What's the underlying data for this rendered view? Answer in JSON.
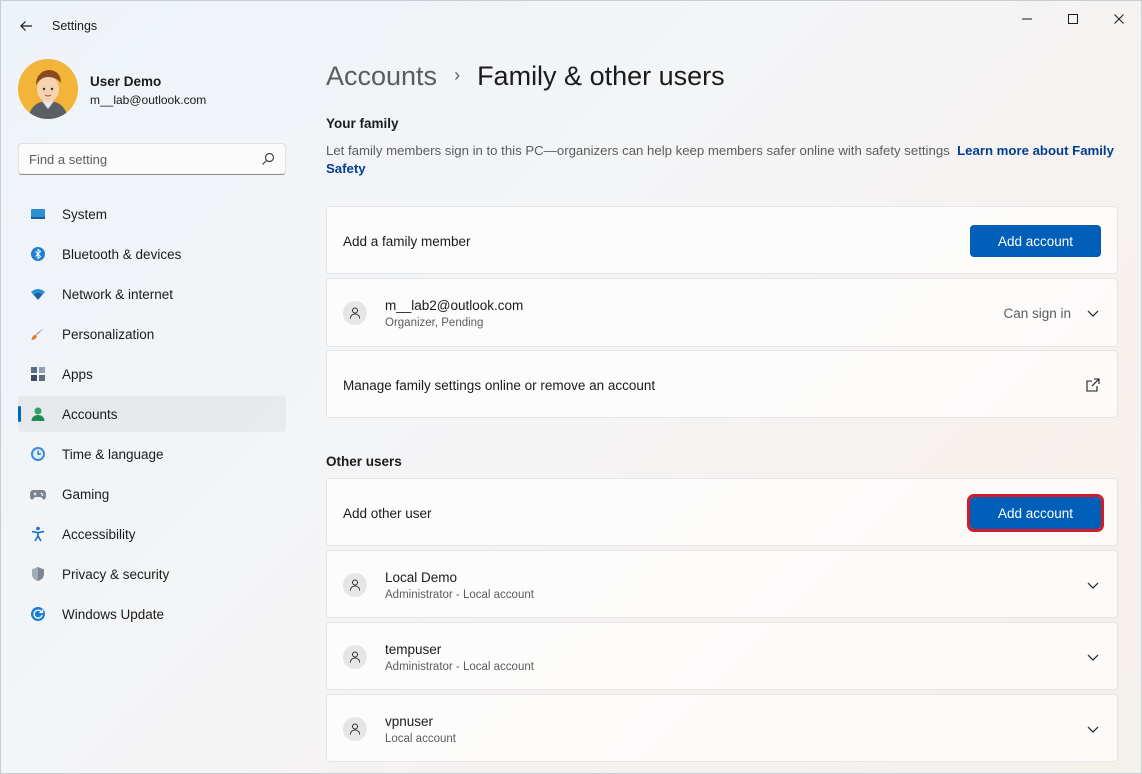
{
  "app": {
    "title": "Settings"
  },
  "profile": {
    "name": "User Demo",
    "email": "m__lab@outlook.com"
  },
  "search": {
    "placeholder": "Find a setting"
  },
  "nav": {
    "items": [
      {
        "label": "System",
        "icon": "system-icon"
      },
      {
        "label": "Bluetooth & devices",
        "icon": "bluetooth-icon"
      },
      {
        "label": "Network & internet",
        "icon": "network-icon"
      },
      {
        "label": "Personalization",
        "icon": "brush-icon"
      },
      {
        "label": "Apps",
        "icon": "apps-icon"
      },
      {
        "label": "Accounts",
        "icon": "accounts-icon",
        "active": true
      },
      {
        "label": "Time & language",
        "icon": "clock-icon"
      },
      {
        "label": "Gaming",
        "icon": "gamepad-icon"
      },
      {
        "label": "Accessibility",
        "icon": "accessibility-icon"
      },
      {
        "label": "Privacy & security",
        "icon": "shield-icon"
      },
      {
        "label": "Windows Update",
        "icon": "update-icon"
      }
    ]
  },
  "breadcrumb": {
    "parent": "Accounts",
    "separator": "›",
    "current": "Family & other users"
  },
  "family": {
    "title": "Your family",
    "description": "Let family members sign in to this PC—organizers can help keep members safer online with safety settings",
    "link": "Learn more about Family Safety",
    "add_label": "Add a family member",
    "add_button": "Add account",
    "member": {
      "email": "m__lab2@outlook.com",
      "role": "Organizer, Pending",
      "status": "Can sign in"
    },
    "manage_label": "Manage family settings online or remove an account"
  },
  "other": {
    "title": "Other users",
    "add_label": "Add other user",
    "add_button": "Add account",
    "users": [
      {
        "name": "Local Demo",
        "sub": "Administrator - Local account"
      },
      {
        "name": "tempuser",
        "sub": "Administrator - Local account"
      },
      {
        "name": "vpnuser",
        "sub": "Local account"
      }
    ]
  },
  "colors": {
    "accent": "#005fb8",
    "highlight": "#d11a2a",
    "link": "#003e92"
  }
}
